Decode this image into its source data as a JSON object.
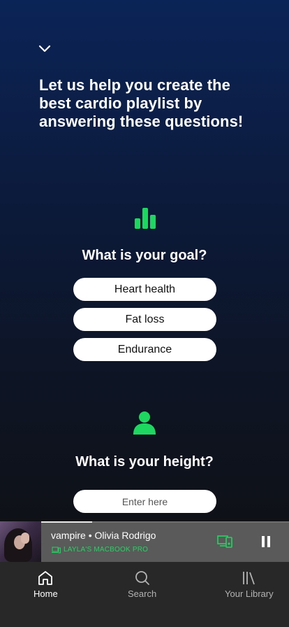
{
  "intro": "Let us help you create the best cardio playlist by answering these questions!",
  "goal": {
    "question": "What is your goal?",
    "options": [
      "Heart health",
      "Fat loss",
      "Endurance"
    ]
  },
  "height": {
    "question": "What is your height?",
    "placeholder": "Enter here"
  },
  "now_playing": {
    "song": "vampire",
    "separator": "•",
    "artist": "Olivia Rodrigo",
    "device": "LAYLA'S MACBOOK PRO",
    "progress": 0.32
  },
  "nav": {
    "home": "Home",
    "search": "Search",
    "library": "Your Library"
  },
  "colors": {
    "accent": "#1ed760",
    "gradient_top": "#0b2457",
    "gradient_bottom": "#0f1117",
    "miniplayer": "#5a5a5a",
    "navbar": "#282828"
  },
  "icons": {
    "collapse": "chevron-down-icon",
    "goal": "bar-chart-icon",
    "height": "person-icon",
    "cast": "devices-icon",
    "pause": "pause-icon",
    "home": "home-icon",
    "search": "search-icon",
    "library": "library-icon"
  }
}
